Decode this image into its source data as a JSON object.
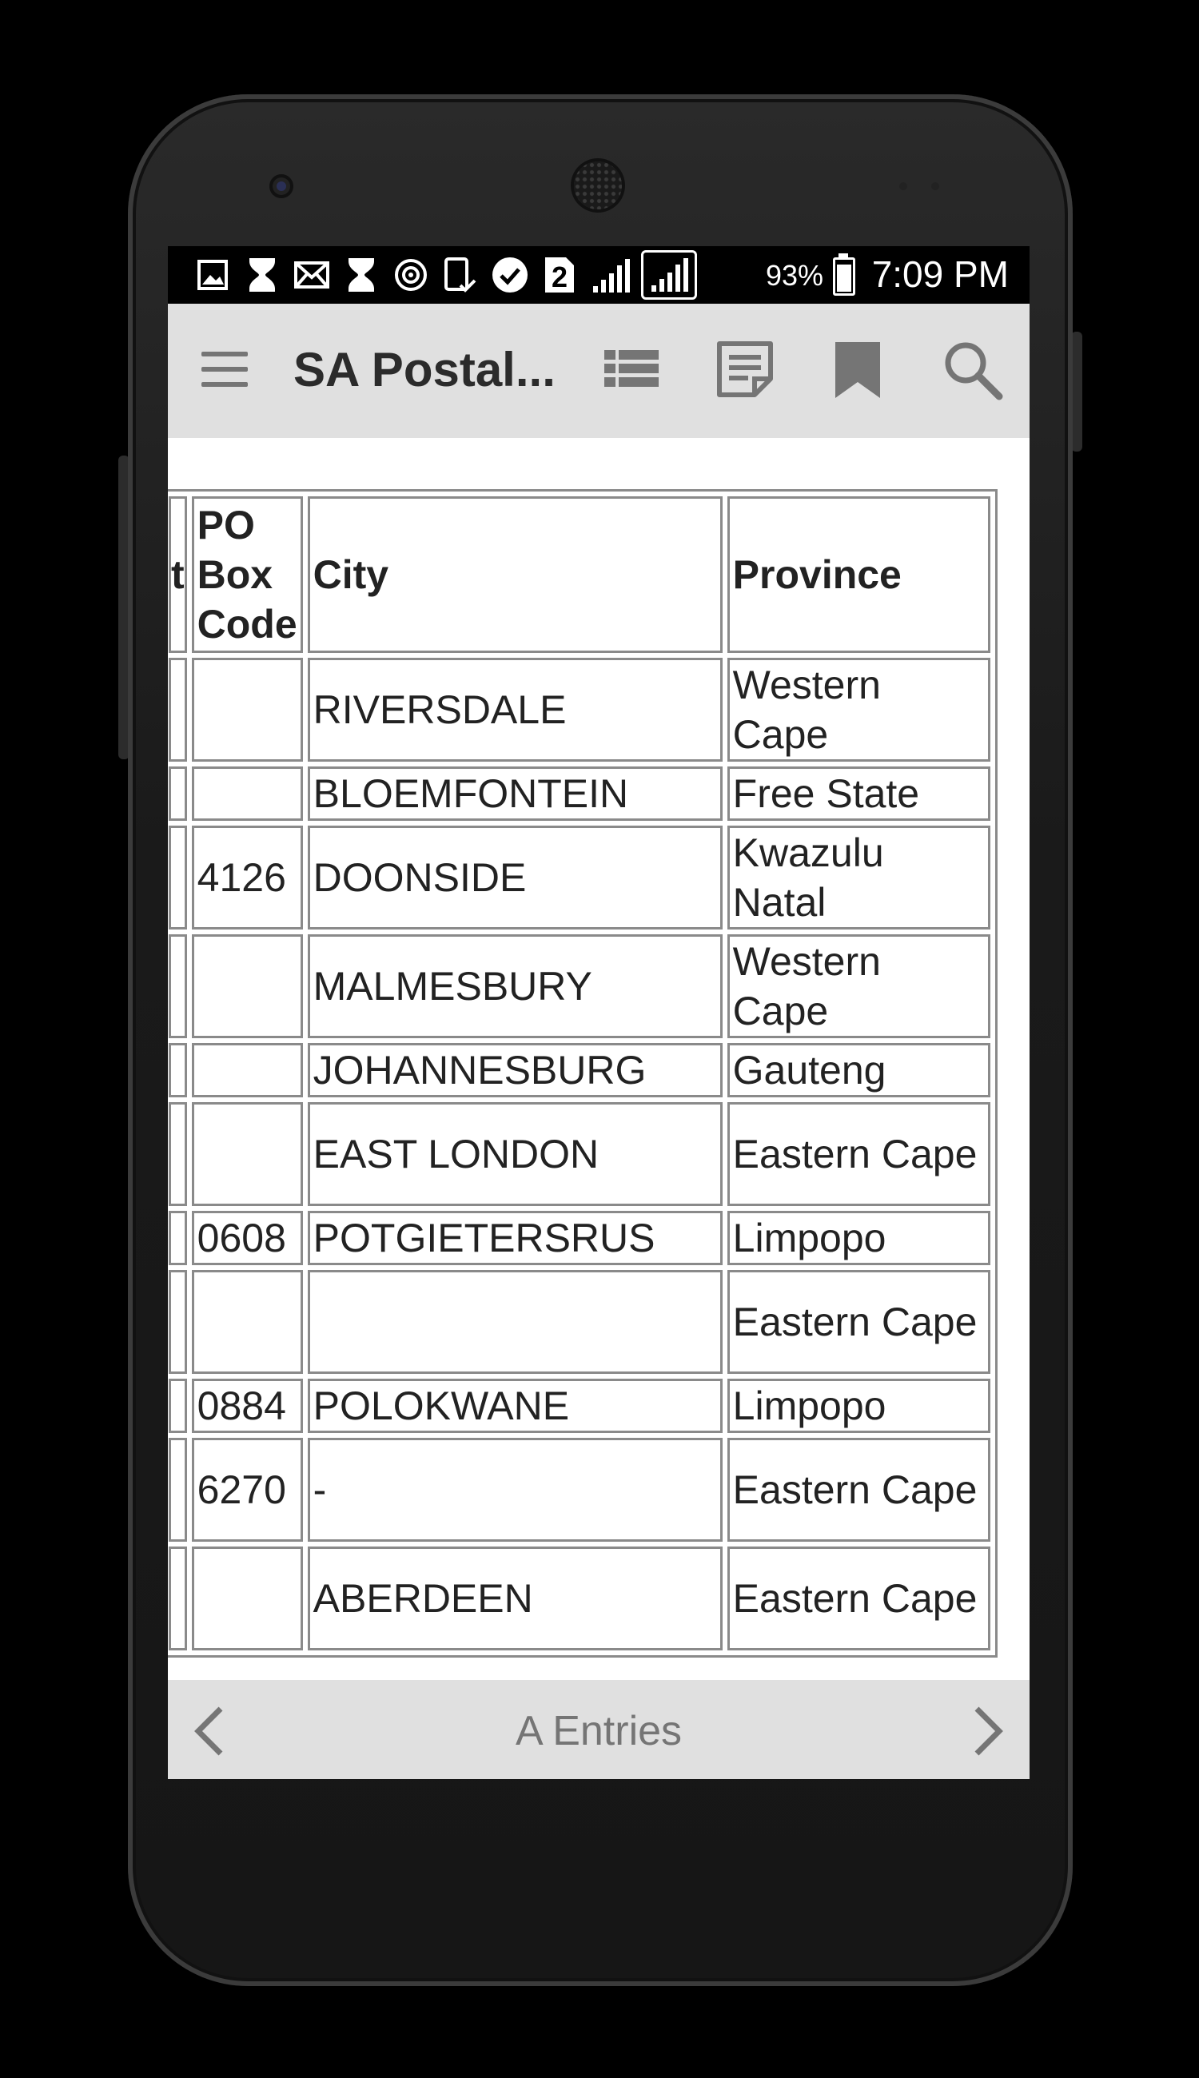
{
  "status_bar": {
    "battery_percent": "93%",
    "time": "7:09 PM",
    "notification_badge": "2",
    "icons": [
      "gallery-icon",
      "hourglass-icon",
      "mail-icon",
      "hourglass-icon",
      "sync-icon",
      "device-check-icon",
      "check-circle-icon",
      "sim-2-icon",
      "signal-icon",
      "signal-icon",
      "battery-icon"
    ]
  },
  "toolbar": {
    "title": "SA Postal...",
    "icons": [
      "menu-icon",
      "list-icon",
      "notes-icon",
      "bookmark-icon",
      "search-icon"
    ]
  },
  "table": {
    "headers": {
      "cut": "t",
      "po_box_code": "PO Box Code",
      "city": "City",
      "province": "Province"
    },
    "rows": [
      {
        "po": "",
        "city": "RIVERSDALE",
        "province": "Western Cape"
      },
      {
        "po": "",
        "city": "BLOEMFONTEIN",
        "province": "Free State"
      },
      {
        "po": "4126",
        "city": "DOONSIDE",
        "province": "Kwazulu Natal"
      },
      {
        "po": "",
        "city": "MALMESBURY",
        "province": "Western Cape"
      },
      {
        "po": "",
        "city": "JOHANNESBURG",
        "province": "Gauteng"
      },
      {
        "po": "",
        "city": "EAST LONDON",
        "province": "Eastern Cape"
      },
      {
        "po": "0608",
        "city": "POTGIETERSRUS",
        "province": "Limpopo"
      },
      {
        "po": "",
        "city": "",
        "province": "Eastern Cape"
      },
      {
        "po": "0884",
        "city": "POLOKWANE",
        "province": "Limpopo"
      },
      {
        "po": "6270",
        "city": "-",
        "province": "Eastern Cape"
      },
      {
        "po": "",
        "city": "ABERDEEN",
        "province": "Eastern Cape"
      }
    ]
  },
  "footer": {
    "title": "A Entries",
    "prev_icon": "chevron-left-icon",
    "next_icon": "chevron-right-icon"
  }
}
